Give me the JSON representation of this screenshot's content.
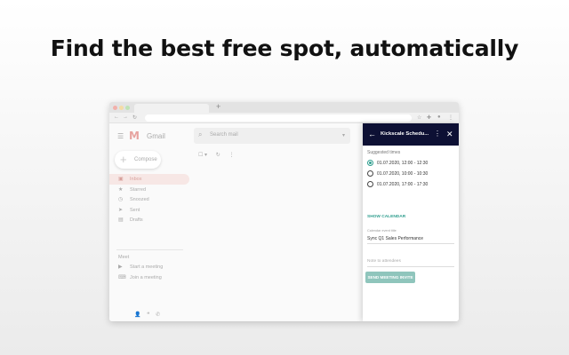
{
  "headline": "Find the best free spot, automatically",
  "gmail": {
    "logo_text": "Gmail",
    "search_placeholder": "Search mail",
    "compose_label": "Compose",
    "nav": [
      {
        "label": "Inbox",
        "icon": "inbox-icon"
      },
      {
        "label": "Starred",
        "icon": "star-icon"
      },
      {
        "label": "Snoozed",
        "icon": "clock-icon"
      },
      {
        "label": "Sent",
        "icon": "send-icon"
      },
      {
        "label": "Drafts",
        "icon": "draft-icon"
      }
    ],
    "meet_title": "Meet",
    "meet_items": [
      {
        "label": "Start a meeting",
        "icon": "video-icon"
      },
      {
        "label": "Join a meeting",
        "icon": "keyboard-icon"
      }
    ]
  },
  "panel": {
    "title": "Kickscale Schedu...",
    "suggested_label": "Suggested times",
    "options": [
      {
        "text": "01.07.2020, 12:00 - 12:30",
        "checked": true
      },
      {
        "text": "01.07.2020, 10:00 - 10:30",
        "checked": false
      },
      {
        "text": "01.07.2020, 17:00 - 17:30",
        "checked": false
      }
    ],
    "show_calendar": "SHOW CALENDAR",
    "event_label": "Calendar event title",
    "event_value": "Sync Q1 Sales Performance",
    "note_placeholder": "Note to attendees",
    "send_label": "SEND MEETING INVITE"
  },
  "colors": {
    "panel_header": "#0d1034",
    "accent": "#2f9e8e",
    "send_button": "#8fc5bc"
  }
}
